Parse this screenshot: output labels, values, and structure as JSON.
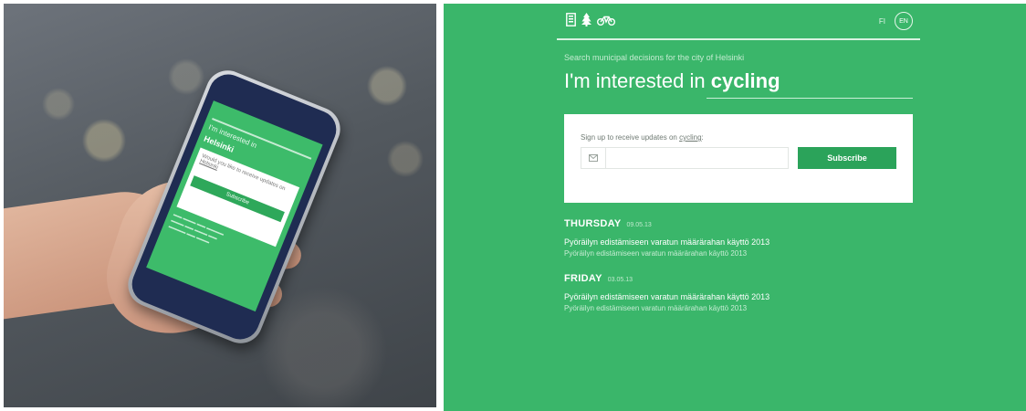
{
  "photo": {
    "phone_screen": {
      "headline_prefix": "I'm interested in",
      "headline_keyword": "Helsinki",
      "card_text": "Would you like to receive updates on",
      "card_topic": "Helsinki",
      "button_label": "Subscribe"
    }
  },
  "header": {
    "icons": [
      "building-icon",
      "tree-icon",
      "bicycle-icon"
    ],
    "lang_fi": "FI",
    "lang_en": "EN"
  },
  "hero": {
    "tagline": "Search municipal decisions for the city of Helsinki",
    "headline_prefix": "I'm interested in ",
    "keyword": "cycling"
  },
  "signup": {
    "label_prefix": "Sign up to receive updates on ",
    "topic": "cycling",
    "label_suffix": ":",
    "email_value": "",
    "email_placeholder": "",
    "subscribe_label": "Subscribe"
  },
  "decisions": [
    {
      "day": "THURSDAY",
      "date": "09.05.13",
      "title": "Pyöräilyn edistämiseen varatun määrärahan käyttö 2013",
      "subtitle": "Pyöräilyn edistämiseen varatun määrärahan käyttö 2013"
    },
    {
      "day": "FRIDAY",
      "date": "03.05.13",
      "title": "Pyöräilyn edistämiseen varatun määrärahan käyttö 2013",
      "subtitle": "Pyöräilyn edistämiseen varatun määrärahan käyttö 2013"
    }
  ],
  "colors": {
    "brand_green": "#3ab66a",
    "button_green": "#2ba35a",
    "card_bg": "#ffffff"
  }
}
